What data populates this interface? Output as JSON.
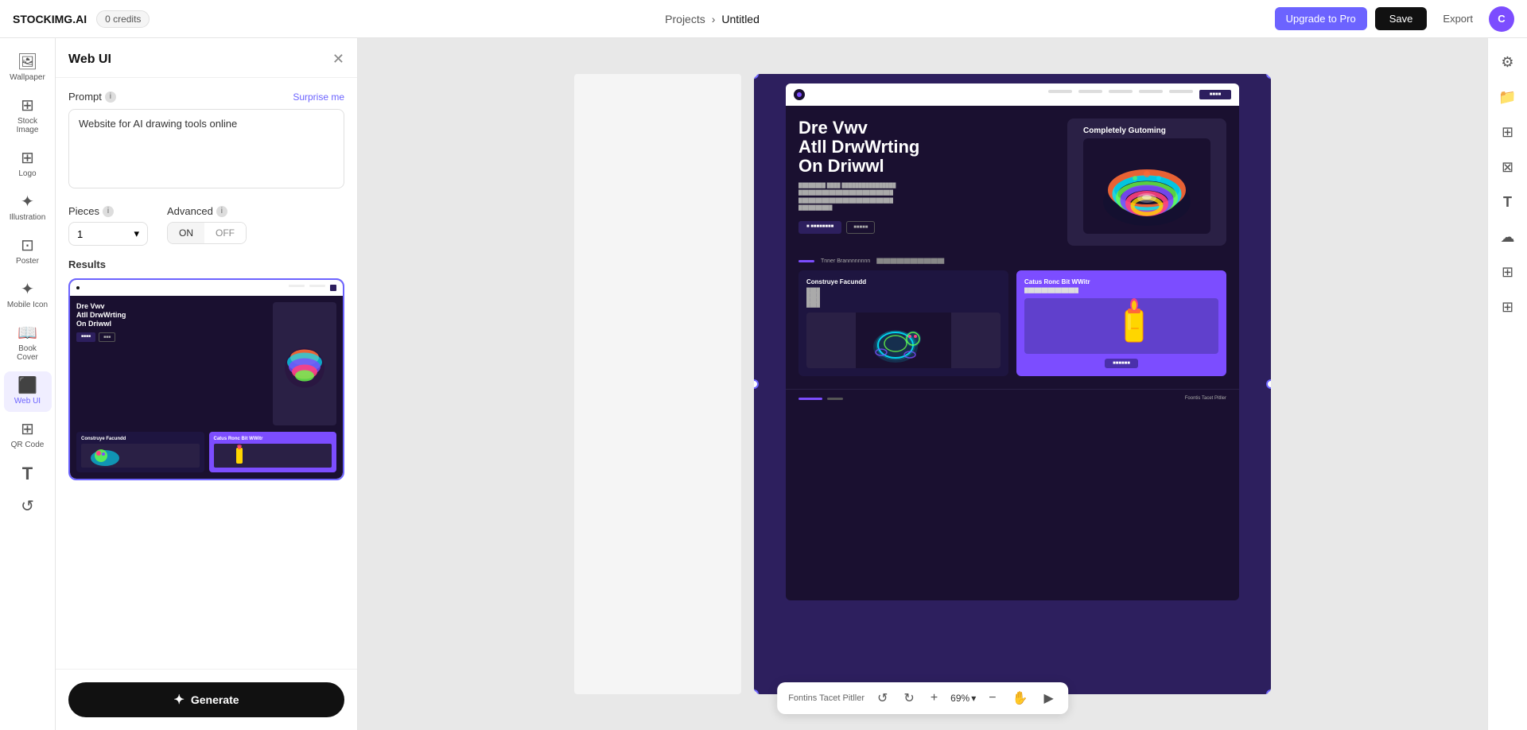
{
  "header": {
    "logo": "STOCKIMG.AI",
    "credits": "0 credits",
    "breadcrumb_projects": "Projects",
    "breadcrumb_sep": "›",
    "breadcrumb_current": "Untitled",
    "btn_upgrade": "Upgrade to Pro",
    "btn_save": "Save",
    "btn_export": "Export",
    "avatar": "C"
  },
  "sidebar": {
    "items": [
      {
        "label": "Wallpaper",
        "icon": "🖼"
      },
      {
        "label": "Stock Image",
        "icon": "⊞"
      },
      {
        "label": "Logo",
        "icon": "⊞"
      },
      {
        "label": "Illustration",
        "icon": "✦"
      },
      {
        "label": "Poster",
        "icon": "⊡"
      },
      {
        "label": "Mobile Icon",
        "icon": "✦"
      },
      {
        "label": "Book Cover",
        "icon": "📖"
      },
      {
        "label": "Web UI",
        "icon": "⬛",
        "active": true
      },
      {
        "label": "QR Code",
        "icon": "⊞"
      },
      {
        "label": "T",
        "icon": "T"
      },
      {
        "label": "History",
        "icon": "↺"
      }
    ]
  },
  "panel": {
    "title": "Web UI",
    "prompt_label": "Prompt",
    "surprise_me": "Surprise me",
    "prompt_value": "Website for AI drawing tools online",
    "pieces_label": "Pieces",
    "pieces_value": "1",
    "advanced_label": "Advanced",
    "advanced_on": "ON",
    "advanced_off": "OFF",
    "results_label": "Results",
    "generate_btn": "Generate"
  },
  "canvas": {
    "bottom_text": "Fontins Tacet Pitller",
    "zoom_level": "69%"
  },
  "right_panel": {
    "icons": [
      "⚙",
      "📁",
      "⊞",
      "⊠",
      "T",
      "☁",
      "⊠",
      "⊞"
    ]
  }
}
